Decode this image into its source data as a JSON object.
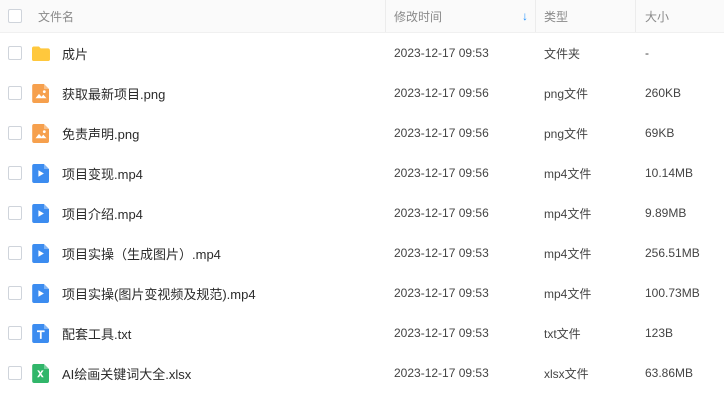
{
  "header": {
    "name": "文件名",
    "time": "修改时间",
    "type": "类型",
    "size": "大小",
    "sort_arrow": "↓"
  },
  "files": [
    {
      "name": "成片",
      "time": "2023-12-17 09:53",
      "type": "文件夹",
      "size": "-",
      "icon": "folder-icon"
    },
    {
      "name": "获取最新项目.png",
      "time": "2023-12-17 09:56",
      "type": "png文件",
      "size": "260KB",
      "icon": "image-file-icon"
    },
    {
      "name": "免责声明.png",
      "time": "2023-12-17 09:56",
      "type": "png文件",
      "size": "69KB",
      "icon": "image-file-icon"
    },
    {
      "name": "项目变现.mp4",
      "time": "2023-12-17 09:56",
      "type": "mp4文件",
      "size": "10.14MB",
      "icon": "video-file-icon"
    },
    {
      "name": "项目介绍.mp4",
      "time": "2023-12-17 09:56",
      "type": "mp4文件",
      "size": "9.89MB",
      "icon": "video-file-icon"
    },
    {
      "name": "项目实操（生成图片）.mp4",
      "time": "2023-12-17 09:53",
      "type": "mp4文件",
      "size": "256.51MB",
      "icon": "video-file-icon"
    },
    {
      "name": "项目实操(图片变视频及规范).mp4",
      "time": "2023-12-17 09:53",
      "type": "mp4文件",
      "size": "100.73MB",
      "icon": "video-file-icon"
    },
    {
      "name": "配套工具.txt",
      "time": "2023-12-17 09:53",
      "type": "txt文件",
      "size": "123B",
      "icon": "text-file-icon"
    },
    {
      "name": "AI绘画关键词大全.xlsx",
      "time": "2023-12-17 09:53",
      "type": "xlsx文件",
      "size": "63.86MB",
      "icon": "excel-file-icon"
    }
  ],
  "colors": {
    "folder": "#FFC83D",
    "image": "#F6A04D",
    "video": "#3C8CF0",
    "text": "#3C8CF0",
    "excel": "#31B66A"
  }
}
